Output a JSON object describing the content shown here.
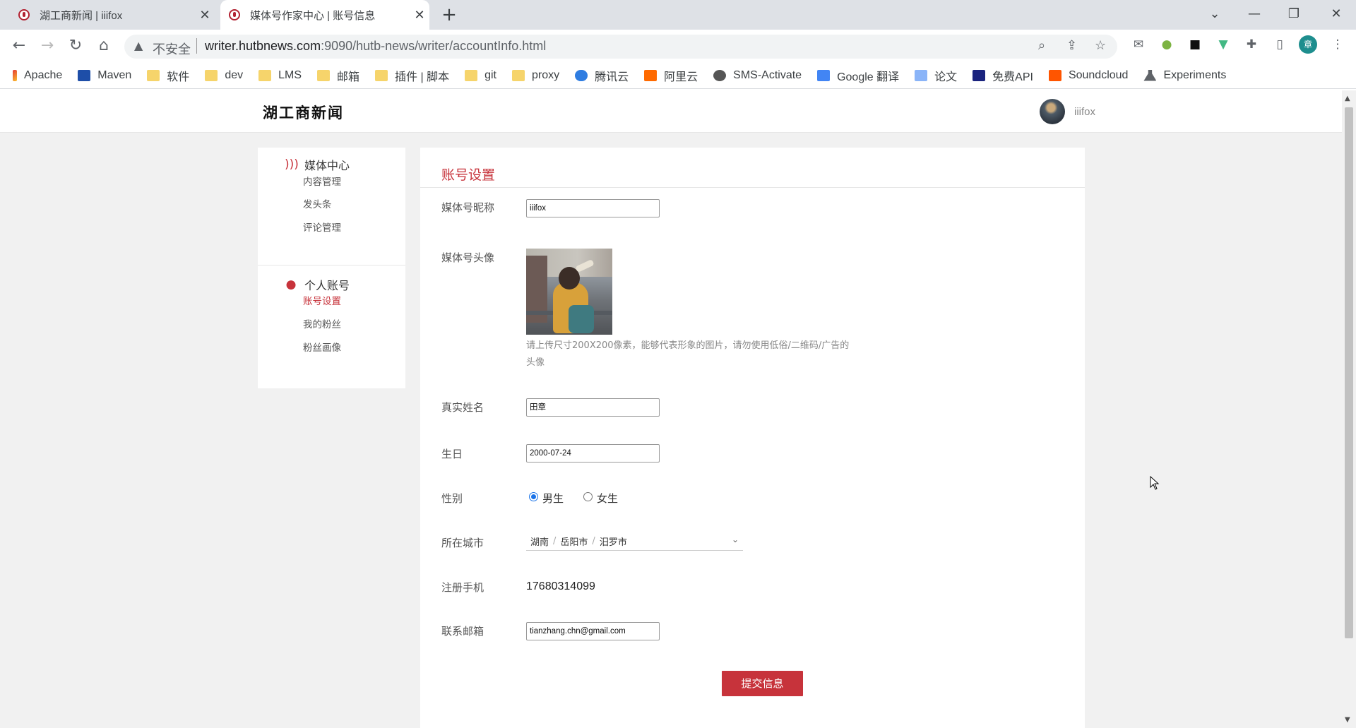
{
  "browser": {
    "tabs": [
      {
        "title": "湖工商新闻 | iiifox",
        "active": false
      },
      {
        "title": "媒体号作家中心 | 账号信息",
        "active": true
      }
    ],
    "security_label": "不安全",
    "url_host": "writer.hutbnews.com",
    "url_path": ":9090/hutb-news/writer/accountInfo.html",
    "bookmarks": [
      "Apache",
      "Maven",
      "软件",
      "dev",
      "LMS",
      "邮箱",
      "插件 | 脚本",
      "git",
      "proxy",
      "腾讯云",
      "阿里云",
      "SMS-Activate",
      "Google 翻译",
      "论文",
      "免费API",
      "Soundcloud",
      "Experiments"
    ],
    "profile_initial": "章"
  },
  "header": {
    "logo": "湖工商新闻",
    "username": "iiifox"
  },
  "sidebar": {
    "groups": [
      {
        "title": "媒体中心",
        "icon": "rss-icon",
        "items": [
          "内容管理",
          "发头条",
          "评论管理"
        ]
      },
      {
        "title": "个人账号",
        "icon": "user-icon",
        "items": [
          "账号设置",
          "我的粉丝",
          "粉丝画像"
        ]
      }
    ],
    "active_item": "账号设置"
  },
  "form": {
    "title": "账号设置",
    "nickname_label": "媒体号昵称",
    "nickname_value": "iiifox",
    "avatar_label": "媒体号头像",
    "avatar_hint": "请上传尺寸200X200像素，能够代表形象的图片，请勿使用低俗/二维码/广告的头像",
    "realname_label": "真实姓名",
    "realname_value": "田章",
    "birthday_label": "生日",
    "birthday_value": "2000-07-24",
    "gender_label": "性别",
    "gender_options": [
      "男生",
      "女生"
    ],
    "gender_selected": "男生",
    "city_label": "所在城市",
    "city_province": "湖南",
    "city_city": "岳阳市",
    "city_district": "汨罗市",
    "phone_label": "注册手机",
    "phone_value": "17680314099",
    "email_label": "联系邮箱",
    "email_value": "tianzhang.chn@gmail.com",
    "submit_label": "提交信息"
  },
  "colors": {
    "accent": "#c7333b",
    "page_bg": "#f1f1f1"
  }
}
